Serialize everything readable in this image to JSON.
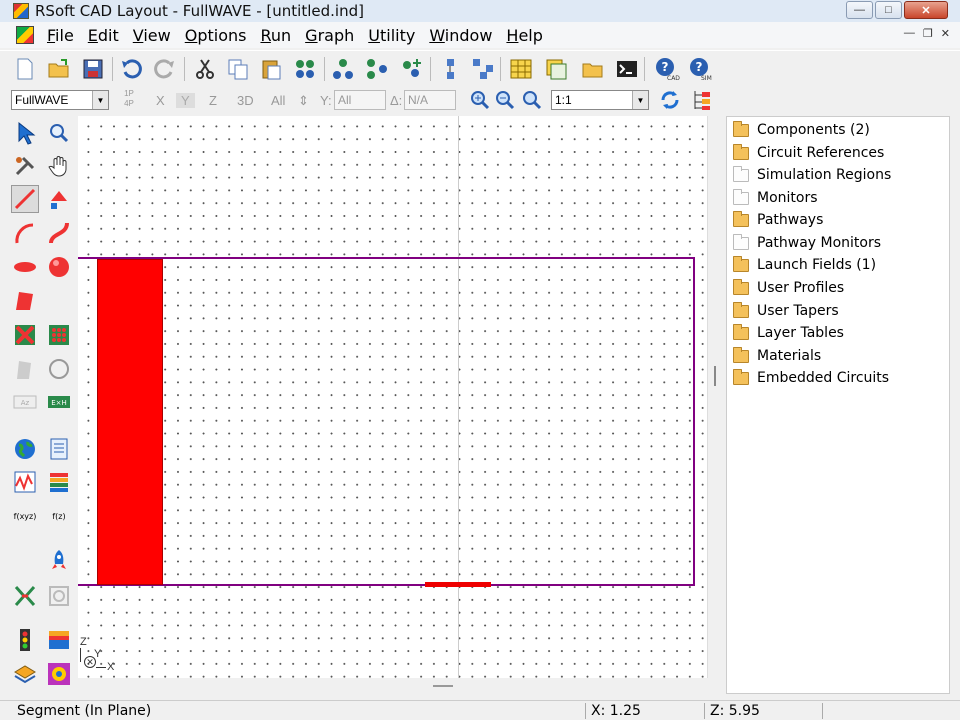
{
  "window": {
    "title": "RSoft CAD Layout - FullWAVE - [untitled.ind]"
  },
  "menu": {
    "items": [
      {
        "ul": "F",
        "rest": "ile"
      },
      {
        "ul": "E",
        "rest": "dit"
      },
      {
        "ul": "V",
        "rest": "iew"
      },
      {
        "ul": "O",
        "rest": "ptions"
      },
      {
        "ul": "R",
        "rest": "un"
      },
      {
        "ul": "G",
        "rest": "raph"
      },
      {
        "ul": "U",
        "rest": "tility"
      },
      {
        "ul": "W",
        "rest": "indow"
      },
      {
        "ul": "H",
        "rest": "elp"
      }
    ]
  },
  "toolbar2": {
    "program_select": "FullWAVE",
    "mode_1p": "1P",
    "mode_4p": "4P",
    "axis_x": "X",
    "axis_y": "Y",
    "axis_z": "Z",
    "view_3d": "3D",
    "all_label": "All",
    "y_label": "Y:",
    "y_value": "All",
    "delta_label": "Δ:",
    "delta_value": "N/A",
    "zoom_select": "1:1"
  },
  "toolbar1": {
    "help_cad_label": "CAD",
    "help_sim_label": "SIM"
  },
  "palette": {
    "az_label": "Az",
    "exh_label": "E×H",
    "fxyz_label": "f(xyz)",
    "fz_label": "f(z)"
  },
  "canvas": {
    "axis_z": "Z",
    "axis_y": "Y",
    "axis_x": "X",
    "colors": {
      "segment": "#ff0000",
      "region": "#800080"
    }
  },
  "tree": {
    "items": [
      {
        "label": "Components (2)",
        "empty": false
      },
      {
        "label": "Circuit References",
        "empty": false
      },
      {
        "label": "Simulation Regions",
        "empty": true
      },
      {
        "label": "Monitors",
        "empty": true
      },
      {
        "label": "Pathways",
        "empty": false
      },
      {
        "label": "Pathway Monitors",
        "empty": true
      },
      {
        "label": "Launch Fields (1)",
        "empty": false
      },
      {
        "label": "User Profiles",
        "empty": false
      },
      {
        "label": "User Tapers",
        "empty": false
      },
      {
        "label": "Layer Tables",
        "empty": false
      },
      {
        "label": "Materials",
        "empty": false
      },
      {
        "label": "Embedded Circuits",
        "empty": false
      }
    ]
  },
  "status": {
    "mode": "Segment (In Plane)",
    "x": "X: 1.25",
    "z": "Z: 5.95"
  }
}
